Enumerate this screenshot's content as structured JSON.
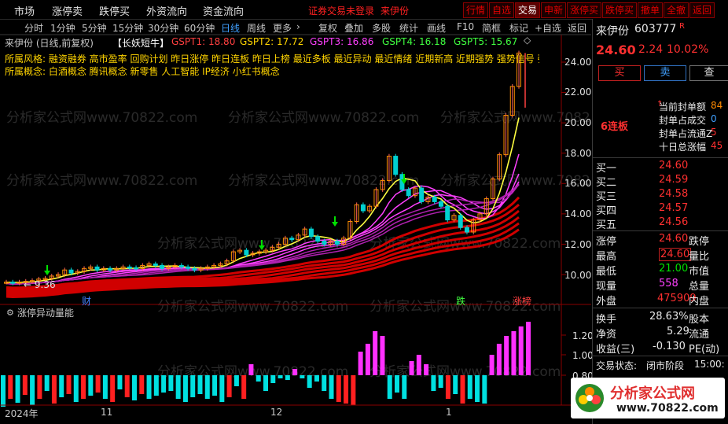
{
  "top_menu": [
    "市场",
    "涨停卖",
    "跌停买",
    "外资流向",
    "资金流向"
  ],
  "login_notice": "证券交易未登录",
  "login_stock": "来伊份",
  "top_buttons": [
    "行情",
    "自选",
    "交易",
    "申新",
    "涨停买",
    "跌停买",
    "撤单",
    "全撤",
    "返回"
  ],
  "periods": [
    "分时",
    "1分钟",
    "5分钟",
    "15分钟",
    "30分钟",
    "60分钟",
    "日线",
    "周线",
    "更多"
  ],
  "period_active": "日线",
  "toolbar_right": [
    "复权",
    "叠加",
    "多股",
    "统计",
    "画线",
    "F10",
    "简框",
    "标记",
    "+自选",
    "返回"
  ],
  "chart": {
    "title": "来伊份 (日线,前复权)",
    "indicator": "【长妖短牛】",
    "gspt": [
      "GSPT1: 18.80",
      "GSPT2: 17.72",
      "GSPT3: 16.86",
      "GSPT4: 16.18",
      "GSPT5: 15.67"
    ],
    "concepts_line1": "所属风格: 融资融券  高市盈率  回购计划  昨日涨停  昨日连板  昨日上榜  最近多板  最近异动  最近情绪  近期新高  近期强势  强势信号  强势股",
    "concepts_line2": "所属概念: 白酒概念  腾讯概念  新零售  人工智能  IP经济  小红书概念",
    "y_ticks": [
      "24.00",
      "22.00",
      "20.00",
      "18.00",
      "16.00",
      "14.00",
      "12.00",
      "10.00"
    ],
    "low_label": "← 9.36",
    "markers": [
      "财",
      "跌",
      "涨榜"
    ],
    "watermark": "分析家公式网www.70822.com",
    "sub_title": "涨停异动量能",
    "sub_y_ticks": [
      "1.20",
      "1.00",
      "0.80"
    ],
    "x_labels": [
      "2024年",
      "11",
      "12",
      "1"
    ]
  },
  "quote": {
    "name": "来伊份",
    "code": "603777",
    "flag": "R",
    "price": "24.60",
    "change": "2.24",
    "change_pct": "10.02%",
    "buttons": [
      "买",
      "卖",
      "查"
    ],
    "streak": "6连板",
    "seal_rows": [
      {
        "label": "当前封单额",
        "value": "84"
      },
      {
        "label": "封单占成交",
        "value": "0"
      },
      {
        "label": "封单占流通Z",
        "value": "5"
      },
      {
        "label": "十日总涨幅",
        "value": "45"
      }
    ],
    "bids": [
      {
        "label": "买一",
        "value": "24.60"
      },
      {
        "label": "买二",
        "value": "24.59"
      },
      {
        "label": "买三",
        "value": "24.58"
      },
      {
        "label": "买四",
        "value": "24.57"
      },
      {
        "label": "买五",
        "value": "24.56"
      }
    ],
    "stats": [
      {
        "l1": "涨停",
        "v1": "24.60",
        "l2": "跌停"
      },
      {
        "l1": "最高",
        "v1": "24.60",
        "l2": "量比"
      },
      {
        "l1": "最低",
        "v1": "21.00",
        "l2": "市值"
      },
      {
        "l1": "现量",
        "v1": "558",
        "l2": "总量"
      },
      {
        "l1": "外盘",
        "v1": "475909",
        "l2": "内盘"
      }
    ],
    "stats2": [
      {
        "l1": "换手",
        "v1": "28.63%",
        "l2": "股本"
      },
      {
        "l1": "净资",
        "v1": "5.29",
        "l2": "流通"
      },
      {
        "l1": "收益(三)",
        "v1": "-0.130",
        "l2": "PE(动)"
      }
    ],
    "status_label": "交易状态:",
    "status_value": "闭市阶段",
    "status_time": "15:00:",
    "logo_text": "分析家公式网",
    "logo_url": "www.70822.com"
  }
}
